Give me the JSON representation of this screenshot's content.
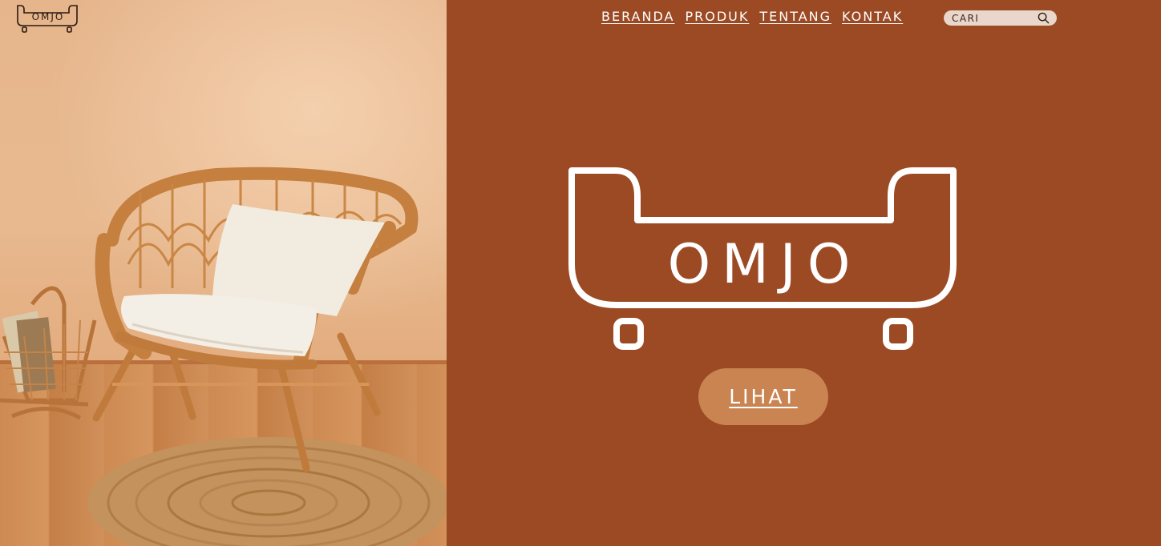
{
  "brand": {
    "logo_text": "OMJO",
    "hero_logo_text": "OMJO"
  },
  "nav": {
    "items": [
      {
        "label": "BERANDA"
      },
      {
        "label": "PRODUK"
      },
      {
        "label": "TENTANG"
      },
      {
        "label": "KONTAK"
      }
    ]
  },
  "search": {
    "placeholder": "CARI",
    "icon": "search-icon"
  },
  "hero": {
    "cta_label": "LIHAT",
    "image": "rattan-armchair-photo"
  },
  "colors": {
    "panel_background": "#9b4a24",
    "cta_background": "#c98452",
    "search_background": "#ead7cb",
    "text": "#ffffff"
  }
}
